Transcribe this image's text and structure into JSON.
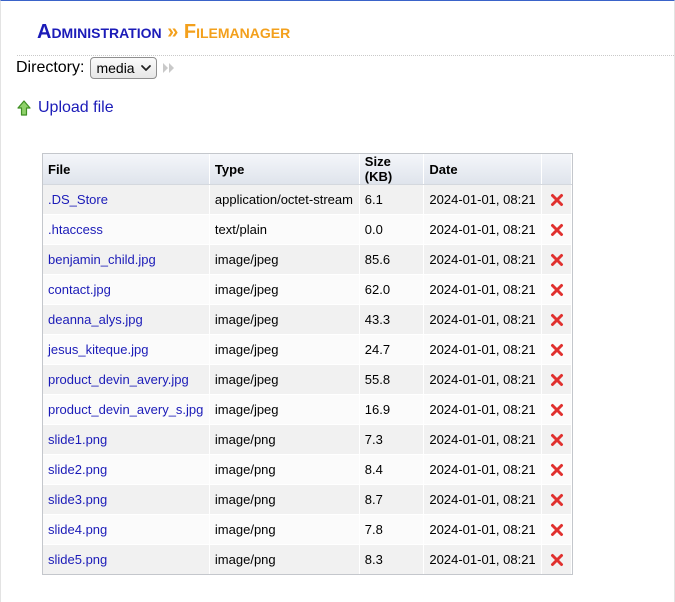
{
  "header": {
    "title_part1": "Administration",
    "separator": "»",
    "title_part2": "Filemanager"
  },
  "directory": {
    "label": "Directory:",
    "selected": "media"
  },
  "upload": {
    "label": "Upload file",
    "icon": "upload-arrow-icon"
  },
  "table": {
    "columns": [
      "File",
      "Type",
      "Size (KB)",
      "Date",
      ""
    ],
    "rows": [
      {
        "file": ".DS_Store",
        "type": "application/octet-stream",
        "size": "6.1",
        "date": "2024-01-01, 08:21"
      },
      {
        "file": ".htaccess",
        "type": "text/plain",
        "size": "0.0",
        "date": "2024-01-01, 08:21"
      },
      {
        "file": "benjamin_child.jpg",
        "type": "image/jpeg",
        "size": "85.6",
        "date": "2024-01-01, 08:21"
      },
      {
        "file": "contact.jpg",
        "type": "image/jpeg",
        "size": "62.0",
        "date": "2024-01-01, 08:21"
      },
      {
        "file": "deanna_alys.jpg",
        "type": "image/jpeg",
        "size": "43.3",
        "date": "2024-01-01, 08:21"
      },
      {
        "file": "jesus_kiteque.jpg",
        "type": "image/jpeg",
        "size": "24.7",
        "date": "2024-01-01, 08:21"
      },
      {
        "file": "product_devin_avery.jpg",
        "type": "image/jpeg",
        "size": "55.8",
        "date": "2024-01-01, 08:21"
      },
      {
        "file": "product_devin_avery_s.jpg",
        "type": "image/jpeg",
        "size": "16.9",
        "date": "2024-01-01, 08:21"
      },
      {
        "file": "slide1.png",
        "type": "image/png",
        "size": "7.3",
        "date": "2024-01-01, 08:21"
      },
      {
        "file": "slide2.png",
        "type": "image/png",
        "size": "8.4",
        "date": "2024-01-01, 08:21"
      },
      {
        "file": "slide3.png",
        "type": "image/png",
        "size": "8.7",
        "date": "2024-01-01, 08:21"
      },
      {
        "file": "slide4.png",
        "type": "image/png",
        "size": "7.8",
        "date": "2024-01-01, 08:21"
      },
      {
        "file": "slide5.png",
        "type": "image/png",
        "size": "8.3",
        "date": "2024-01-01, 08:21"
      }
    ]
  },
  "colors": {
    "title_blue": "#1b1bb8",
    "title_orange": "#f3a01c",
    "link_blue": "#1b1bb8",
    "delete_red": "#e0302e"
  }
}
